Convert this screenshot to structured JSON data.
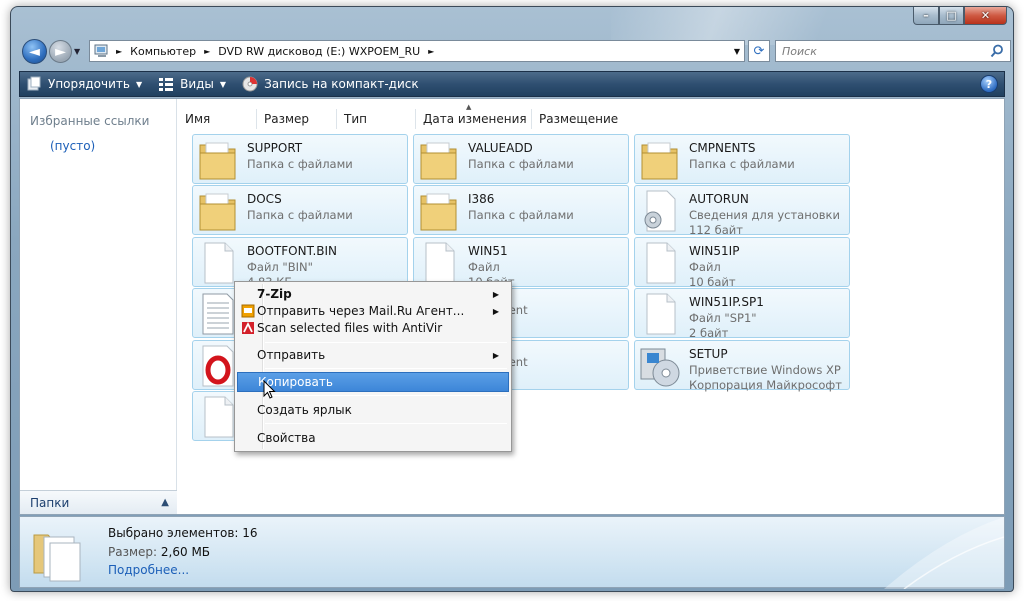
{
  "window": {
    "controls": {
      "minimize": "–",
      "maximize": "□",
      "close": "✕"
    }
  },
  "address_bar": {
    "crumbs": [
      "Компьютер",
      "DVD RW дисковод (E:) WXPOEM_RU"
    ],
    "search_placeholder": "Поиск"
  },
  "toolbar": {
    "organize": "Упорядочить",
    "views": "Виды",
    "burn": "Запись на компакт-диск",
    "help": "?"
  },
  "nav_pane": {
    "favorites_title": "Избранные ссылки",
    "empty": "(пусто)",
    "folders": "Папки"
  },
  "columns": [
    "Имя",
    "Размер",
    "Тип",
    "Дата изменения",
    "Размещение"
  ],
  "tiles": [
    {
      "name": "SUPPORT",
      "line1": "Папка с файлами",
      "line2": "",
      "icon": "folder-icon"
    },
    {
      "name": "VALUEADD",
      "line1": "Папка с файлами",
      "line2": "",
      "icon": "folder-icon"
    },
    {
      "name": "CMPNENTS",
      "line1": "Папка с файлами",
      "line2": "",
      "icon": "folder-icon"
    },
    {
      "name": "DOCS",
      "line1": "Папка с файлами",
      "line2": "",
      "icon": "folder-icon"
    },
    {
      "name": "I386",
      "line1": "Папка с файлами",
      "line2": "",
      "icon": "folder-icon"
    },
    {
      "name": "AUTORUN",
      "line1": "Сведения для установки",
      "line2": "112 байт",
      "icon": "settings-file-icon"
    },
    {
      "name": "BOOTFONT.BIN",
      "line1": "Файл \"BIN\"",
      "line2": "4,83 КБ",
      "icon": "file-icon"
    },
    {
      "name": "WIN51",
      "line1": "Файл",
      "line2": "10 байт",
      "icon": "file-icon"
    },
    {
      "name": "WIN51IP",
      "line1": "Файл",
      "line2": "10 байт",
      "icon": "file-icon"
    },
    {
      "name": "",
      "line1": "",
      "line2": "",
      "icon": "text-file-icon"
    },
    {
      "name": "",
      "line1": "Document",
      "line2": "",
      "icon": "file-icon"
    },
    {
      "name": "WIN51IP.SP1",
      "line1": "Файл \"SP1\"",
      "line2": "2 байт",
      "icon": "file-icon"
    },
    {
      "name": "",
      "line1": "",
      "line2": "",
      "icon": "opera-icon"
    },
    {
      "name": "",
      "line1": "Document",
      "line2": "",
      "icon": "file-icon"
    },
    {
      "name": "SETUP",
      "line1": "Приветствие Windows XP",
      "line2": "Корпорация Майкрософт",
      "icon": "setup-icon"
    },
    {
      "name": "",
      "line1": "",
      "line2": "",
      "icon": "file-icon"
    }
  ],
  "context_menu": {
    "items": [
      {
        "label": "7-Zip",
        "submenu": true
      },
      {
        "label": "Отправить через Mail.Ru Агент...",
        "submenu": true
      },
      {
        "label": "Scan selected files with AntiVir",
        "submenu": false
      },
      {
        "label": "Отправить",
        "submenu": true
      },
      {
        "label": "Копировать",
        "submenu": false
      },
      {
        "label": "Создать ярлык",
        "submenu": false
      },
      {
        "label": "Свойства",
        "submenu": false
      }
    ],
    "highlighted": "Копировать"
  },
  "details": {
    "selected": "Выбрано элементов: 16",
    "size_label": "Размер:",
    "size_value": "2,60 МБ",
    "more": "Подробнее..."
  },
  "colors": {
    "tile_border": "#a4d2ec",
    "tile_bg": "#dff0fa",
    "highlight": "#3d86d8",
    "toolbar": "#2f4f71",
    "link": "#1c5fb8"
  }
}
